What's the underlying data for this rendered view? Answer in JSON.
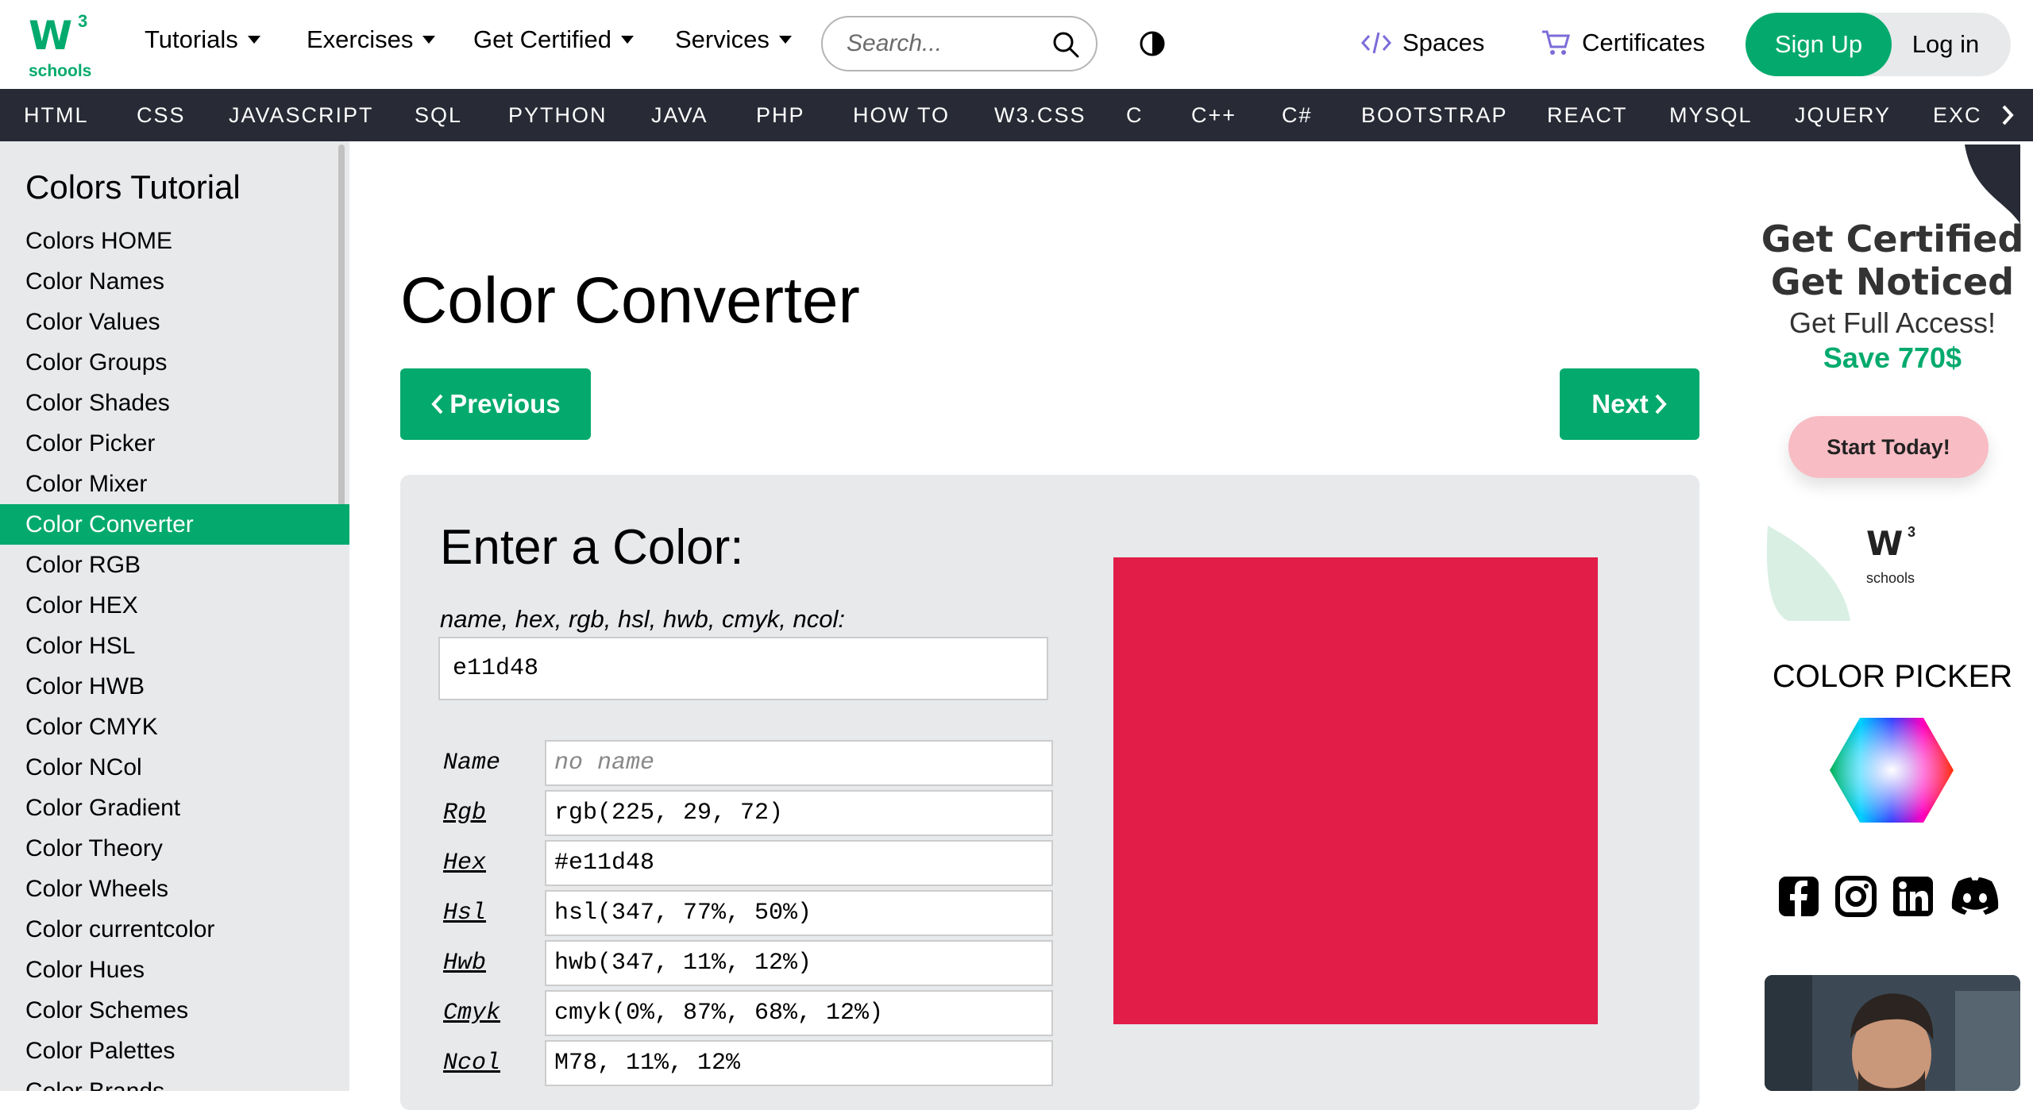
{
  "brand": {
    "superscript": "3",
    "wordmark": "schools"
  },
  "top_nav": {
    "tutorials": "Tutorials",
    "exercises": "Exercises",
    "get_certified": "Get Certified",
    "services": "Services",
    "search_placeholder": "Search...",
    "spaces": "Spaces",
    "certificates": "Certificates",
    "sign_up": "Sign Up",
    "log_in": "Log in"
  },
  "sub_nav": [
    "HTML",
    "CSS",
    "JAVASCRIPT",
    "SQL",
    "PYTHON",
    "JAVA",
    "PHP",
    "HOW TO",
    "W3.CSS",
    "C",
    "C++",
    "C#",
    "BOOTSTRAP",
    "REACT",
    "MYSQL",
    "JQUERY",
    "EXCE"
  ],
  "sidebar": {
    "title": "Colors Tutorial",
    "items": [
      "Colors HOME",
      "Color Names",
      "Color Values",
      "Color Groups",
      "Color Shades",
      "Color Picker",
      "Color Mixer",
      "Color Converter",
      "Color RGB",
      "Color HEX",
      "Color HSL",
      "Color HWB",
      "Color CMYK",
      "Color NCol",
      "Color Gradient",
      "Color Theory",
      "Color Wheels",
      "Color currentcolor",
      "Color Hues",
      "Color Schemes",
      "Color Palettes",
      "Color Brands"
    ],
    "active_index": 7
  },
  "main": {
    "title": "Color Converter",
    "previous": "Previous",
    "next": "Next",
    "panel_title": "Enter a Color:",
    "hint": "name, hex, rgb, hsl, hwb, cmyk, ncol:",
    "input_value": "e11d48",
    "rows": [
      {
        "label": "Name",
        "value": "no name"
      },
      {
        "label": "Rgb",
        "value": "rgb(225, 29, 72)"
      },
      {
        "label": "Hex",
        "value": "#e11d48"
      },
      {
        "label": "Hsl",
        "value": "hsl(347, 77%, 50%)"
      },
      {
        "label": "Hwb",
        "value": "hwb(347, 11%, 12%)"
      },
      {
        "label": "Cmyk",
        "value": "cmyk(0%, 87%, 68%, 12%)"
      },
      {
        "label": "Ncol",
        "value": "M78, 11%, 12%"
      }
    ],
    "swatch_color": "#e11d48"
  },
  "ad": {
    "line1": "Get Certified",
    "line2": "Get Noticed",
    "line3": "Get Full Access!",
    "line4": "Save 770$",
    "cta": "Start Today!",
    "mini_wordmark": "schools",
    "mini_superscript": "3"
  },
  "color_picker": {
    "title": "COLOR PICKER"
  },
  "colors": {
    "accent": "#04aa6d",
    "subnav_bg": "#282a35",
    "panel_bg": "#e7e9eb"
  }
}
